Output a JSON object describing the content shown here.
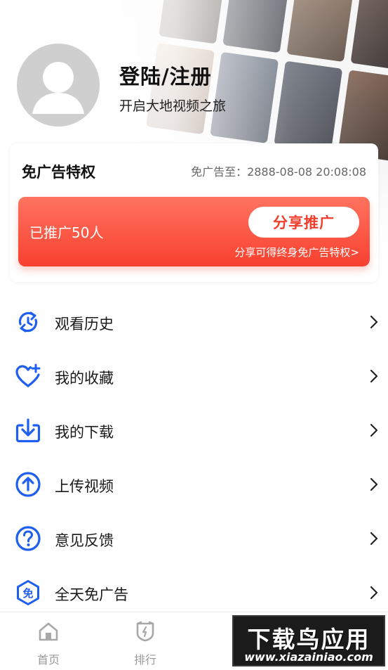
{
  "profile": {
    "login_title": "登陆/注册",
    "subtitle": "开启大地视频之旅"
  },
  "ad_card": {
    "title": "免广告特权",
    "expire_text": "免广告至：2888-08-08 20:08:08",
    "promo_count": "已推广50人",
    "share_button": "分享推广",
    "hint": "分享可得终身免广告特权>"
  },
  "menu": {
    "items": [
      {
        "label": "观看历史",
        "icon": "history-icon"
      },
      {
        "label": "我的收藏",
        "icon": "heart-plus-icon"
      },
      {
        "label": "我的下载",
        "icon": "download-icon"
      },
      {
        "label": "上传视频",
        "icon": "upload-icon"
      },
      {
        "label": "意见反馈",
        "icon": "question-icon"
      },
      {
        "label": "全天免广告",
        "icon": "ad-free-icon"
      }
    ],
    "ad_free_glyph": "免"
  },
  "bottom_nav": {
    "items": [
      {
        "label": "首页",
        "icon": "home-icon"
      },
      {
        "label": "排行",
        "icon": "ranking-icon"
      }
    ]
  },
  "watermark": {
    "title": "下载鸟应用",
    "url": "www.xiazainiao.com"
  },
  "colors": {
    "accent_blue": "#1f5ff0",
    "promo_red": "#f8402f",
    "text_dark": "#1a1a1a",
    "muted": "#9a9a9a"
  }
}
